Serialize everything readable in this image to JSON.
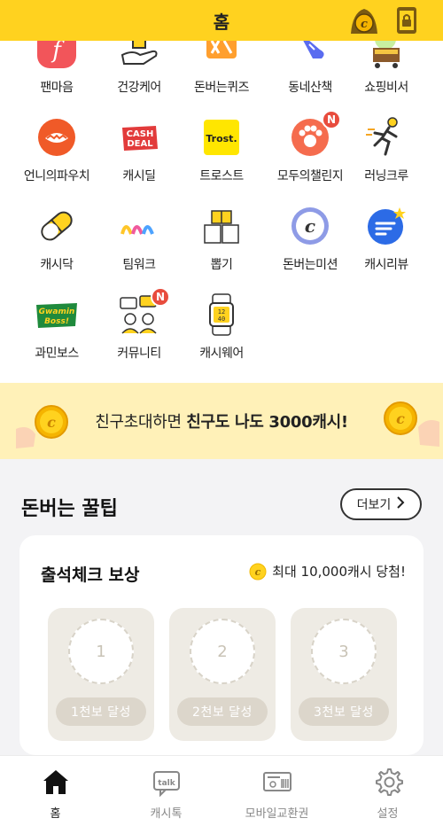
{
  "header": {
    "title": "홈"
  },
  "grid": {
    "row0": [
      "팬마음",
      "건강케어",
      "돈버는퀴즈",
      "동네산책",
      "쇼핑비서"
    ],
    "row1": [
      "언니의파우치",
      "캐시딜",
      "트로스트",
      "모두의챌린지",
      "러닝크루"
    ],
    "row2": [
      "캐시닥",
      "팀워크",
      "뽑기",
      "돈버는미션",
      "캐시리뷰"
    ],
    "row3": [
      "과민보스",
      "커뮤니티",
      "캐시웨어"
    ],
    "badge": "N",
    "icon_text": {
      "cashdeal_line1": "CASH",
      "cashdeal_line2": "DEAL",
      "trost": "Trost.",
      "gwamin_line1": "Gwamin",
      "gwamin_line2": "Boss!",
      "cashwear_line1": "12",
      "cashwear_line2": "40",
      "coin_letter": "c"
    }
  },
  "banner": {
    "text_plain": "친구초대하면 ",
    "text_bold": "친구도 나도 3000캐시!"
  },
  "tips": {
    "heading": "돈버는 꿀팁",
    "more_label": "더보기",
    "card": {
      "title": "출석체크 보상",
      "reward_text": "최대 10,000캐시 당첨!",
      "steps": [
        {
          "number": "1",
          "label": "1천보 달성"
        },
        {
          "number": "2",
          "label": "2천보 달성"
        },
        {
          "number": "3",
          "label": "3천보 달성"
        }
      ]
    }
  },
  "bottom_nav": [
    {
      "label": "홈",
      "icon": "home-icon",
      "active": true
    },
    {
      "label": "캐시톡",
      "icon": "talk-icon",
      "active": false
    },
    {
      "label": "모바일교환권",
      "icon": "voucher-icon",
      "active": false
    },
    {
      "label": "설정",
      "icon": "gear-icon",
      "active": false
    }
  ],
  "colors": {
    "brand_yellow": "#FFD21F",
    "badge_red": "#E84C3D",
    "banner_bg": "#FFF1B8"
  }
}
